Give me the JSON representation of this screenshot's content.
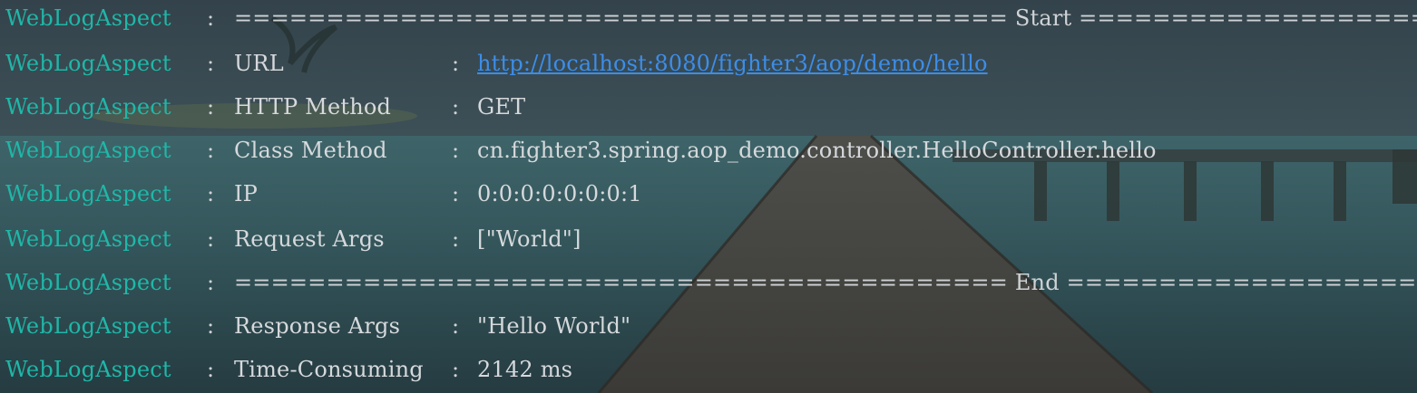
{
  "console": {
    "lines": [
      {
        "logger": "WebLogAspect",
        "separator": ":",
        "rule": "========================================== Start =========================================="
      },
      {
        "logger": "WebLogAspect",
        "separator": ":",
        "label": "URL",
        "value_separator": ":",
        "value": "http://localhost:8080/fighter3/aop/demo/hello"
      },
      {
        "logger": "WebLogAspect",
        "separator": ":",
        "label": "HTTP Method",
        "value_separator": ":",
        "value": "GET"
      },
      {
        "logger": "WebLogAspect",
        "separator": ":",
        "label": "Class Method",
        "value_separator": ":",
        "value": "cn.fighter3.spring.aop_demo.controller.HelloController.hello"
      },
      {
        "logger": "WebLogAspect",
        "separator": ":",
        "label": "IP",
        "value_separator": ":",
        "value": "0:0:0:0:0:0:0:1"
      },
      {
        "logger": "WebLogAspect",
        "separator": ":",
        "label": "Request Args",
        "value_separator": ":",
        "value": "[\"World\"]"
      },
      {
        "logger": "WebLogAspect",
        "separator": ":",
        "rule": "========================================== End =========================================="
      },
      {
        "logger": "WebLogAspect",
        "separator": ":",
        "label": "Response Args",
        "value_separator": ":",
        "value": "\"Hello World\""
      },
      {
        "logger": "WebLogAspect",
        "separator": ":",
        "label": "Time-Consuming",
        "value_separator": ":",
        "value": "2142 ms"
      }
    ]
  },
  "colors": {
    "logger": "#1fb7a8",
    "text": "#d6d9dc",
    "link": "#3d8de8",
    "background": "#2f3b42"
  },
  "background_scene": "tropical-pier-over-sea"
}
